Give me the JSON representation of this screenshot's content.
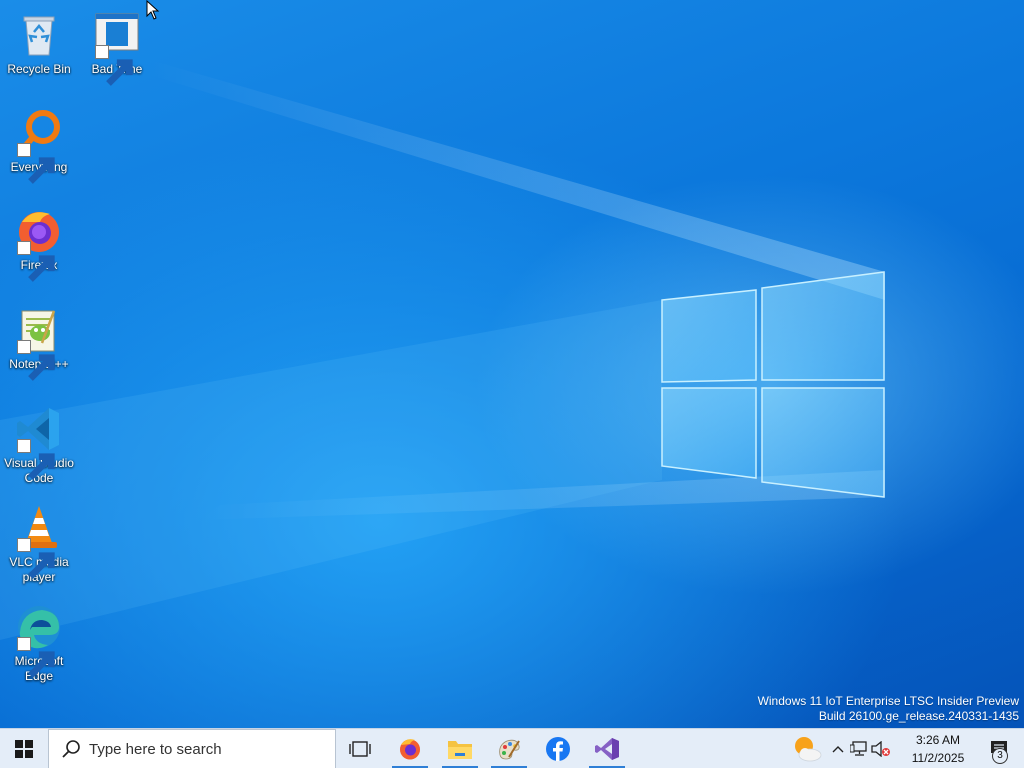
{
  "desktop": {
    "icons": [
      {
        "label": "Recycle Bin",
        "icon": "recycle-bin-icon",
        "shortcut": false
      },
      {
        "label": "Bad Time",
        "icon": "bad-time-icon",
        "shortcut": true
      },
      {
        "label": "Everything",
        "icon": "everything-icon",
        "shortcut": true
      },
      {
        "label": "Firefox",
        "icon": "firefox-icon",
        "shortcut": true
      },
      {
        "label": "Notepad++",
        "icon": "notepad-plus-plus-icon",
        "shortcut": true
      },
      {
        "label": "Visual Studio Code",
        "icon": "vscode-icon",
        "shortcut": true
      },
      {
        "label": "VLC media player",
        "icon": "vlc-icon",
        "shortcut": true
      },
      {
        "label": "Microsoft Edge",
        "icon": "edge-icon",
        "shortcut": true
      }
    ],
    "watermark": {
      "line1": "Windows 11 IoT Enterprise LTSC Insider Preview",
      "line2": "Build 26100.ge_release.240331-1435"
    }
  },
  "taskbar": {
    "start_icon": "windows-logo-icon",
    "search": {
      "placeholder": "Type here to search"
    },
    "apps": [
      {
        "name": "Task View",
        "icon": "task-view-icon",
        "active": false
      },
      {
        "name": "Firefox",
        "icon": "firefox-icon",
        "active": true
      },
      {
        "name": "File Explorer",
        "icon": "file-explorer-icon",
        "active": true
      },
      {
        "name": "Paint",
        "icon": "paint-icon",
        "active": true
      },
      {
        "name": "Facebook",
        "icon": "facebook-icon",
        "active": false
      },
      {
        "name": "Visual Studio",
        "icon": "visual-studio-icon",
        "active": true
      }
    ],
    "tray": {
      "weather_icon": "weather-partly-sunny-icon",
      "time": "3:26 AM",
      "date": "11/2/2025",
      "notification_count": "3"
    }
  },
  "colors": {
    "accent": "#2f7fd6",
    "taskbar_bg": "#e4edf8",
    "wallpaper": "#0a6fd6"
  }
}
